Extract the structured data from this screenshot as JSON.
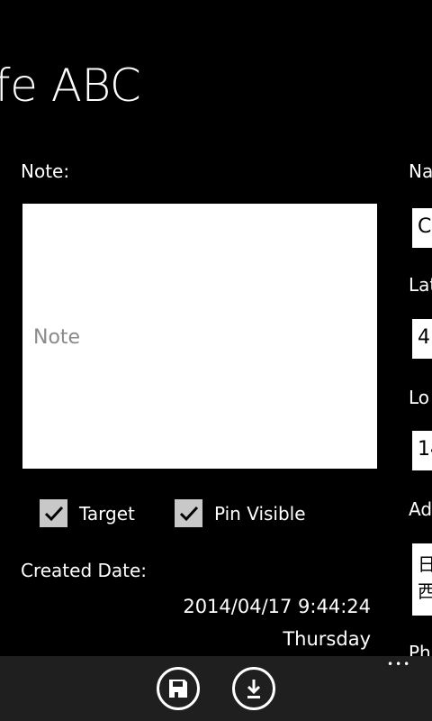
{
  "title": "fe ABC",
  "note": {
    "label": "Note:",
    "placeholder": "Note"
  },
  "checkboxes": [
    {
      "label": "Target",
      "checked": true
    },
    {
      "label": "Pin Visible",
      "checked": true
    }
  ],
  "created": {
    "label": "Created Date:",
    "datetime": "2014/04/17 9:44:24",
    "weekday": "Thursday"
  },
  "right": {
    "name_label": "Na",
    "name_value": "C",
    "lat_label": "Lat",
    "lat_value": "4",
    "lon_label": "Lo",
    "lon_value": "14",
    "addr_label": "Ad",
    "addr_line1": "日",
    "addr_line2": "西",
    "phone_label": "Ph"
  },
  "appbar": {
    "more": "•••"
  }
}
